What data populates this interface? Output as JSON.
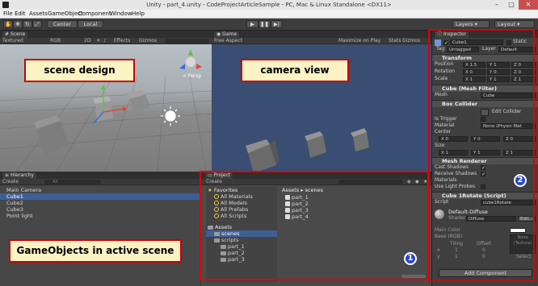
{
  "window": {
    "title": "Unity - part_4.unity - CodeProjectArticleSample - PC, Mac & Linux Standalone <DX11>",
    "minimize": "–",
    "maximize": "□",
    "close": "✕"
  },
  "menu": [
    "File",
    "Edit",
    "Assets",
    "GameObject",
    "Component",
    "Window",
    "Help"
  ],
  "toolbar": {
    "pivot": "Center",
    "space": "Local",
    "play": "▶",
    "pause": "❚❚",
    "step": "▶|",
    "layers": "Layers",
    "layout": "Layout"
  },
  "scene": {
    "tab_label": "Scene",
    "tab_icon": "#",
    "mode": "Textured",
    "render": "RGB",
    "toggle_2d": "2D",
    "effects": "Effects",
    "gizmos": "Gizmos",
    "persp_label": "< Persp",
    "callout": "scene design"
  },
  "game": {
    "tab_label": "Game",
    "aspect": "Free Aspect",
    "maximize_on_play": "Maximize on Play",
    "stats": "Stats",
    "gizmos": "Gizmos",
    "callout": "camera view"
  },
  "hierarchy": {
    "tab_label": "Hierarchy",
    "create": "Create",
    "search_placeholder": "All",
    "items": [
      {
        "label": "Main Camera",
        "selected": false
      },
      {
        "label": "Cube1",
        "selected": true
      },
      {
        "label": "Cube2",
        "selected": false
      },
      {
        "label": "Cube3",
        "selected": false
      },
      {
        "label": "Point light",
        "selected": false
      }
    ],
    "callout": "GameObjects in active scene"
  },
  "project": {
    "tab_label": "Project",
    "create": "Create",
    "favorites_title": "Favorites",
    "favorites": [
      "All Materials",
      "All Models",
      "All Prefabs",
      "All Scripts"
    ],
    "assets_title": "Assets",
    "tree": [
      "scenes",
      "scripts",
      "part_1",
      "part_2",
      "part_3"
    ],
    "breadcrumb": "Assets ▸ scenes",
    "files": [
      "part_1",
      "part_2",
      "part_3",
      "part_4"
    ],
    "badge": "1"
  },
  "inspector": {
    "tab_label": "Inspector",
    "object_name": "Cube1",
    "static_label": "Static",
    "tag_label": "Tag",
    "tag_value": "Untagged",
    "layer_label": "Layer",
    "layer_value": "Default",
    "transform": {
      "title": "Transform",
      "position_label": "Position",
      "rotation_label": "Rotation",
      "scale_label": "Scale",
      "position": [
        "X 1.5",
        "Y 1",
        "Z 0"
      ],
      "rotation": [
        "X 0",
        "Y 0",
        "Z 0"
      ],
      "scale": [
        "X 1",
        "Y 1",
        "Z 1"
      ]
    },
    "mesh_filter": {
      "title": "Cube (Mesh Filter)",
      "mesh_label": "Mesh",
      "mesh_value": "Cube"
    },
    "box_collider": {
      "title": "Box Collider",
      "edit_label": "Edit Collider",
      "is_trigger": "Is Trigger",
      "material_label": "Material",
      "material_value": "None (Physic Mat",
      "center_label": "Center",
      "center": [
        "X 0",
        "Y 0",
        "Z 0"
      ],
      "size_label": "Size",
      "size": [
        "X 1",
        "Y 1",
        "Z 1"
      ]
    },
    "mesh_renderer": {
      "title": "Mesh Renderer",
      "cast_shadows": "Cast Shadows",
      "receive_shadows": "Receive Shadows",
      "materials": "Materials",
      "light_probes": "Use Light Probes"
    },
    "script_comp": {
      "title": "Cube 1Rotate (Script)",
      "script_label": "Script",
      "script_value": "cube1Rotate"
    },
    "material": {
      "name": "Default-Diffuse",
      "shader_label": "Shader",
      "shader_value": "Diffuse",
      "edit_button": "Edit...",
      "main_color": "Main Color",
      "base_label": "Base (RGB)",
      "tiling": "Tiling",
      "offset": "Offset",
      "none_label": "None (Texture)",
      "select": "Select",
      "x_label": "x",
      "y_label": "y",
      "tx": "1",
      "ty": "1",
      "ox": "0",
      "oy": "0"
    },
    "add_component": "Add Component",
    "badge": "2"
  },
  "colors": {
    "highlight_red": "#e00000",
    "callout_bg": "#fbf3c4",
    "badge_blue": "#2748c7",
    "selection": "#3e5f96",
    "game_bg": "#3a4d73"
  }
}
